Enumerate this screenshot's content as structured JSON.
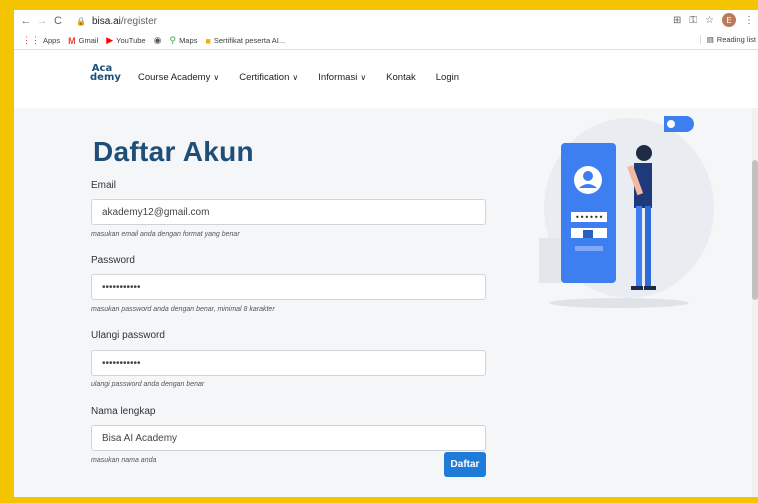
{
  "browser": {
    "url_host": "bisa.ai",
    "url_path": "/register",
    "profile_initial": "E",
    "bookmarks": [
      {
        "label": "Apps",
        "icon": "apps-grid-icon"
      },
      {
        "label": "Gmail",
        "icon": "gmail-icon"
      },
      {
        "label": "YouTube",
        "icon": "youtube-icon"
      },
      {
        "label": "",
        "icon": "chrome-icon"
      },
      {
        "label": "Maps",
        "icon": "maps-icon"
      },
      {
        "label": "Sertifikat peserta AI...",
        "icon": "folder-icon"
      }
    ],
    "reading_list": "Reading list"
  },
  "site": {
    "logo_text": "Aca demy",
    "nav": [
      {
        "label": "Course Academy",
        "dropdown": true
      },
      {
        "label": "Certification",
        "dropdown": true
      },
      {
        "label": "Informasi",
        "dropdown": true
      },
      {
        "label": "Kontak",
        "dropdown": false
      },
      {
        "label": "Login",
        "dropdown": false
      }
    ]
  },
  "form": {
    "title": "Daftar Akun",
    "email": {
      "label": "Email",
      "value": "akademy12@gmail.com",
      "help": "masukan email anda dengan format yang benar"
    },
    "password": {
      "label": "Password",
      "value": "•••••••••••",
      "help": "masukan password anda dengan benar, minimal 8 karakter"
    },
    "confirm": {
      "label": "Ulangi password",
      "value": "•••••••••••",
      "help": "ulangi password anda dengan benar"
    },
    "fullname": {
      "label": "Nama lengkap",
      "value": "Bisa AI Academy",
      "help": "masukan nama anda"
    },
    "submit": "Daftar"
  },
  "colors": {
    "frame": "#f4c400",
    "title": "#1f4e79",
    "button": "#1e7bd8"
  }
}
